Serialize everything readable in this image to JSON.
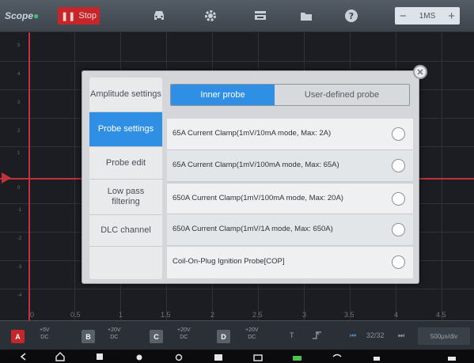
{
  "app": {
    "logo_text": "Scope",
    "stop_label": "Stop",
    "timebase_value": "1MS",
    "timebase_minus": "−",
    "timebase_plus": "+"
  },
  "toolbar_icons": [
    "car-icon",
    "gear-icon",
    "print-icon",
    "folder-icon",
    "help-icon"
  ],
  "graph": {
    "x_ticks": [
      "0",
      "0.5",
      "1",
      "1.5",
      "2",
      "2.5",
      "3",
      "3.5",
      "4",
      "4.5"
    ],
    "y_ticks": [
      "5",
      "4",
      "3",
      "2",
      "1",
      "0",
      "-1",
      "-2",
      "-3",
      "-4"
    ]
  },
  "channels": [
    {
      "tag": "A",
      "range": "+5V",
      "coupling": "DC",
      "color": "#c6262a"
    },
    {
      "tag": "B",
      "range": "+20V",
      "coupling": "DC",
      "color": "#58606a"
    },
    {
      "tag": "C",
      "range": "+20V",
      "coupling": "DC",
      "color": "#58606a"
    },
    {
      "tag": "D",
      "range": "+20V",
      "coupling": "DC",
      "color": "#58606a"
    }
  ],
  "bottom_controls": {
    "trigger_label": "T",
    "edge_icon": "rising-edge-icon",
    "page": "32/32",
    "time_per_div": "500μs/div"
  },
  "dialog": {
    "sidebar": [
      {
        "label": "Amplitude settings",
        "active": false
      },
      {
        "label": "Probe settings",
        "active": true
      },
      {
        "label": "Probe edit",
        "active": false
      },
      {
        "label": "Low pass filtering",
        "active": false
      },
      {
        "label": "DLC channel",
        "active": false
      }
    ],
    "tabs": {
      "inner": "Inner probe",
      "user": "User-defined probe"
    },
    "probes": [
      "65A Current Clamp(1mV/10mA mode, Max: 2A)",
      "65A Current Clamp(1mV/100mA mode, Max: 65A)",
      "650A Current Clamp(1mV/100mA mode, Max: 20A)",
      "650A Current Clamp(1mV/1A mode, Max: 650A)",
      "Coil-On-Plug Ignition Probe[COP]"
    ],
    "close_icon": "close-icon"
  },
  "colors": {
    "accent_blue": "#2f8fe5",
    "trace_red": "#c2323a",
    "stop_red": "#c6262a"
  }
}
